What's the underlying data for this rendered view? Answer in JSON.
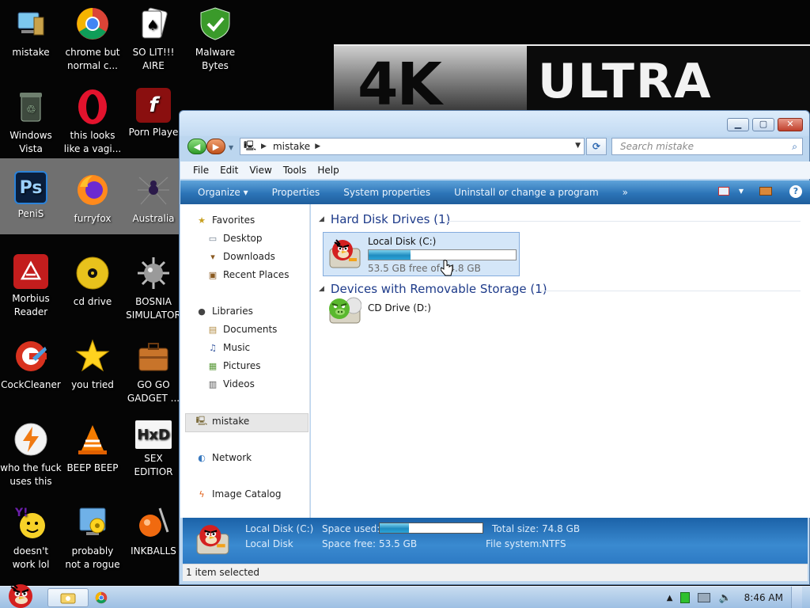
{
  "desktop": {
    "wallpaper_text_left": "4K",
    "wallpaper_text_right": "ULTRA",
    "icons": [
      {
        "label": "mistake",
        "icon": "computer-icon"
      },
      {
        "label": "chrome but\nnormal c...",
        "icon": "chrome-icon"
      },
      {
        "label": "SO LIT!!!\nAIRE",
        "icon": "cards-icon"
      },
      {
        "label": "Malware\nBytes",
        "icon": "shield-icon"
      },
      {
        "label": "Windows\nVista",
        "icon": "recycle-bin-icon"
      },
      {
        "label": "this looks\nlike a vagi...",
        "icon": "opera-icon"
      },
      {
        "label": "Porn Playe",
        "icon": "flash-icon"
      },
      {
        "label": "PeniS",
        "icon": "photoshop-icon"
      },
      {
        "label": "furryfox",
        "icon": "firefox-icon"
      },
      {
        "label": "Australia",
        "icon": "spider-icon"
      },
      {
        "label": "Morbius\nReader",
        "icon": "pdf-icon"
      },
      {
        "label": "cd drive",
        "icon": "cd-icon"
      },
      {
        "label": "BOSNIA\nSIMULATOR",
        "icon": "mine-icon"
      },
      {
        "label": "CockCleaner",
        "icon": "ccleaner-icon"
      },
      {
        "label": "you tried",
        "icon": "star-icon"
      },
      {
        "label": "GO GO\nGADGET ...",
        "icon": "briefcase-icon"
      },
      {
        "label": "who the fuck\nuses this",
        "icon": "lightning-icon"
      },
      {
        "label": "BEEP BEEP",
        "icon": "vlc-icon"
      },
      {
        "label": "SEX\nEDITIOR",
        "icon": "hxd-icon"
      },
      {
        "label": "doesn't\nwork lol",
        "icon": "yahoo-icon"
      },
      {
        "label": "probably\nnot a rogue",
        "icon": "settings-icon"
      },
      {
        "label": "INKBALLS",
        "icon": "ball-icon"
      }
    ]
  },
  "window": {
    "address": "mistake",
    "search_placeholder": "Search mistake",
    "menu": [
      "File",
      "Edit",
      "View",
      "Tools",
      "Help"
    ],
    "commands": [
      "Organize ▾",
      "Properties",
      "System properties",
      "Uninstall or change a program",
      "»"
    ],
    "nav": {
      "favorites": "Favorites",
      "favorites_items": [
        "Desktop",
        "Downloads",
        "Recent Places"
      ],
      "libraries": "Libraries",
      "libraries_items": [
        "Documents",
        "Music",
        "Pictures",
        "Videos"
      ],
      "computer": "mistake",
      "network": "Network",
      "image_catalog": "Image Catalog"
    },
    "groups": {
      "hdd": "Hard Disk Drives (1)",
      "removable": "Devices with Removable Storage (1)"
    },
    "drive_c": {
      "name": "Local Disk (C:)",
      "free_text": "53.5 GB free of 74.8 GB",
      "used_fraction": 0.285
    },
    "drive_d": {
      "name": "CD Drive (D:)"
    },
    "details": {
      "name": "Local Disk (C:)",
      "type": "Local Disk",
      "space_used_label": "Space used:",
      "space_free_label": "Space free:",
      "space_free": "53.5 GB",
      "total_size_label": "Total size:",
      "total_size": "74.8 GB",
      "fs_label": "File system:",
      "fs": "NTFS"
    },
    "status": "1 item selected"
  },
  "taskbar": {
    "clock": "8:46 AM"
  },
  "colors": {
    "accent": "#2c74b7",
    "bar_fill": "#1f8cc0",
    "group_header": "#1e3b8a"
  }
}
